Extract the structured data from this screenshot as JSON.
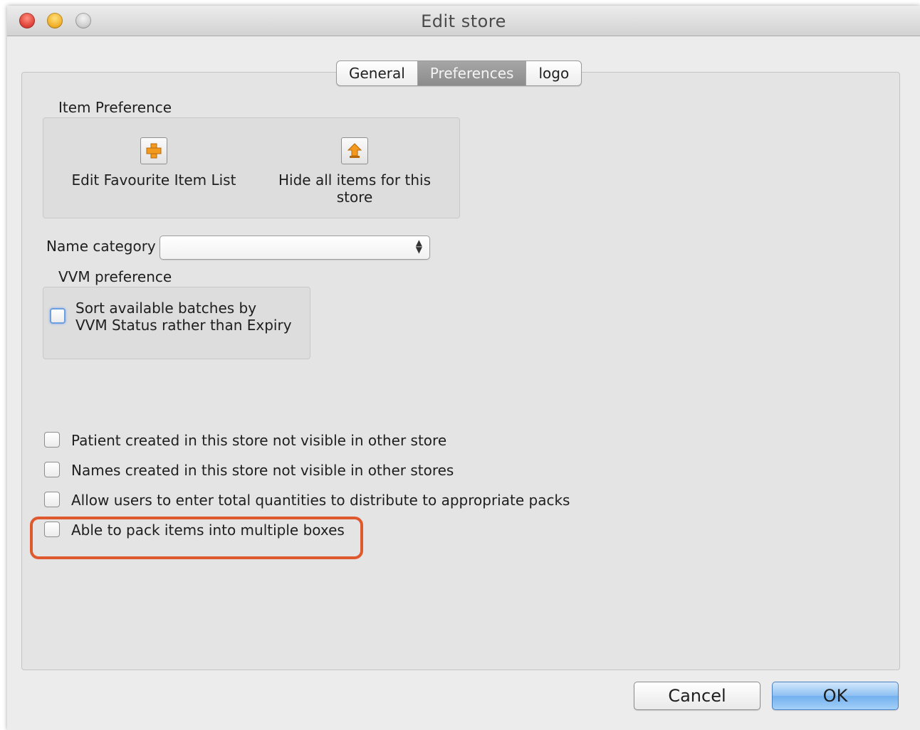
{
  "window": {
    "title": "Edit store"
  },
  "tabs": [
    {
      "label": "General",
      "active": false
    },
    {
      "label": "Preferences",
      "active": true
    },
    {
      "label": "logo",
      "active": false
    }
  ],
  "item_preference": {
    "label": "Item Preference",
    "buttons": [
      {
        "label": "Edit Favourite Item List",
        "icon": "add-icon"
      },
      {
        "label": "Hide all items for this store",
        "icon": "hide-icon"
      }
    ]
  },
  "name_category": {
    "label": "Name category",
    "value": ""
  },
  "vvm_preference": {
    "label": "VVM preference",
    "checkbox": {
      "label": "Sort available batches by VVM Status rather than Expiry",
      "checked": false
    }
  },
  "options": [
    {
      "label": "Patient created in this store not visible in other store",
      "checked": false
    },
    {
      "label": "Names created in this store not visible in other stores",
      "checked": false
    },
    {
      "label": "Allow users to enter total quantities to distribute to appropriate packs",
      "checked": false
    },
    {
      "label": "Able to pack items into multiple boxes",
      "checked": false,
      "highlighted": true
    }
  ],
  "footer": {
    "cancel_label": "Cancel",
    "ok_label": "OK"
  },
  "colors": {
    "highlight": "#e0592e",
    "icon_accent": "#f39a1e",
    "ok_button": "#8dc0f2"
  }
}
